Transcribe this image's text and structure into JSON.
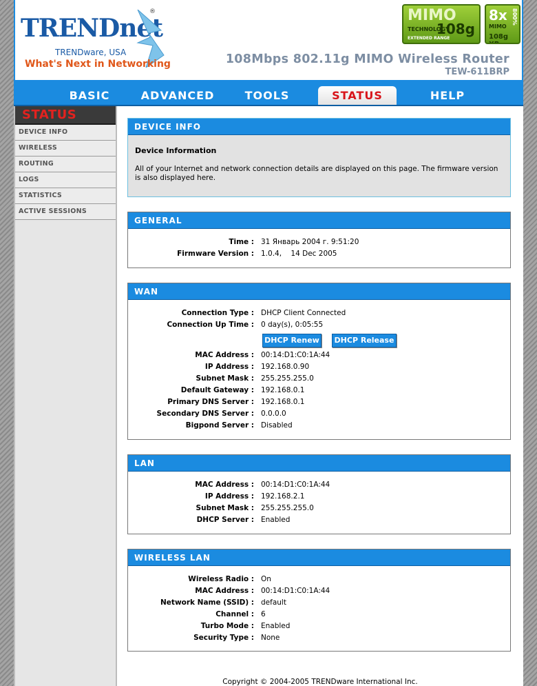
{
  "header": {
    "logo": "TRENDnet",
    "logo_reg": "®",
    "logo_sub1": "TRENDware, USA",
    "logo_sub2": "What's Next in Networking",
    "badge1": {
      "big": "MIMO",
      "tech": "TECHNOLOGY",
      "num": "108g",
      "ext": "EXTENDED RANGE"
    },
    "badge2": {
      "x": "8x",
      "p": "800%",
      "m": "MIMO",
      "n": "108g XR"
    },
    "product_title": "108Mbps 802.11g MIMO Wireless Router",
    "product_model": "TEW-611BRP"
  },
  "nav": {
    "tabs": [
      {
        "label": "BASIC"
      },
      {
        "label": "ADVANCED"
      },
      {
        "label": "TOOLS"
      },
      {
        "label": "STATUS",
        "active": true
      },
      {
        "label": "HELP"
      }
    ]
  },
  "sidebar": {
    "title": "STATUS",
    "items": [
      {
        "label": "DEVICE INFO"
      },
      {
        "label": "WIRELESS"
      },
      {
        "label": "ROUTING"
      },
      {
        "label": "LOGS"
      },
      {
        "label": "STATISTICS"
      },
      {
        "label": "ACTIVE SESSIONS"
      }
    ]
  },
  "device_info": {
    "heading": "DEVICE INFO",
    "title": "Device Information",
    "text": "All of your Internet and network connection details are displayed on this page. The firmware version is also displayed here."
  },
  "general": {
    "heading": "GENERAL",
    "rows": [
      {
        "label": "Time :",
        "value": "31 Январь 2004 г. 9:51:20"
      },
      {
        "label": "Firmware Version :",
        "value": "1.0.4,    14 Dec 2005"
      }
    ]
  },
  "wan": {
    "heading": "WAN",
    "rows_top": [
      {
        "label": "Connection Type :",
        "value": "DHCP Client Connected"
      },
      {
        "label": "Connection Up Time :",
        "value": "0 day(s), 0:05:55"
      }
    ],
    "buttons": {
      "renew": "DHCP Renew",
      "release": "DHCP Release"
    },
    "rows_bottom": [
      {
        "label": "MAC Address :",
        "value": "00:14:D1:C0:1A:44"
      },
      {
        "label": "IP Address :",
        "value": "192.168.0.90"
      },
      {
        "label": "Subnet Mask :",
        "value": "255.255.255.0"
      },
      {
        "label": "Default Gateway :",
        "value": "192.168.0.1"
      },
      {
        "label": "Primary DNS Server :",
        "value": "192.168.0.1"
      },
      {
        "label": "Secondary DNS Server :",
        "value": "0.0.0.0"
      },
      {
        "label": "Bigpond Server :",
        "value": "Disabled"
      }
    ]
  },
  "lan": {
    "heading": "LAN",
    "rows": [
      {
        "label": "MAC Address :",
        "value": "00:14:D1:C0:1A:44"
      },
      {
        "label": "IP Address :",
        "value": "192.168.2.1"
      },
      {
        "label": "Subnet Mask :",
        "value": "255.255.255.0"
      },
      {
        "label": "DHCP Server :",
        "value": "Enabled"
      }
    ]
  },
  "wireless_lan": {
    "heading": "WIRELESS LAN",
    "rows": [
      {
        "label": "Wireless Radio :",
        "value": "On"
      },
      {
        "label": "MAC Address :",
        "value": "00:14:D1:C0:1A:44"
      },
      {
        "label": "Network Name (SSID) :",
        "value": "default"
      },
      {
        "label": "Channel :",
        "value": "6"
      },
      {
        "label": "Turbo Mode :",
        "value": "Enabled"
      },
      {
        "label": "Security Type :",
        "value": "None"
      }
    ]
  },
  "footer": {
    "copyright": "Copyright © 2004-2005 TRENDware International Inc."
  }
}
